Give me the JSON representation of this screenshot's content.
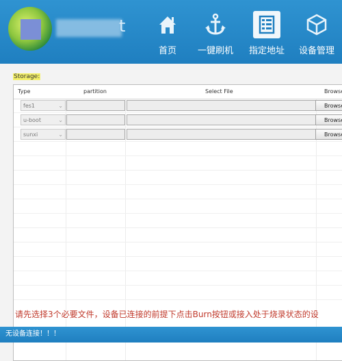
{
  "header": {
    "logo_text": "t",
    "nav": [
      {
        "label": "首页",
        "icon": "home-icon",
        "active": false
      },
      {
        "label": "一键刷机",
        "icon": "anchor-icon",
        "active": false
      },
      {
        "label": "指定地址",
        "icon": "list-icon",
        "active": true
      },
      {
        "label": "设备管理",
        "icon": "cube-icon",
        "active": false
      }
    ]
  },
  "storage_label": "Storage:",
  "table": {
    "columns": [
      "Type",
      "partition",
      "Select File",
      "Browse"
    ],
    "rows": [
      {
        "type": "fes1",
        "partition": "",
        "file": "",
        "button": "Browse"
      },
      {
        "type": "u-boot",
        "partition": "",
        "file": "",
        "button": "Browse"
      },
      {
        "type": "sunxi",
        "partition": "",
        "file": "",
        "button": "Browse"
      }
    ]
  },
  "message": "请先选择3个必要文件，设备已连接的前提下点击Burn按钮或接入处于烧录状态的设",
  "status": "无设备连接！！！",
  "colors": {
    "header": "#2a8cd0",
    "accent_red": "#c0392b",
    "highlight": "#f4f06a"
  }
}
